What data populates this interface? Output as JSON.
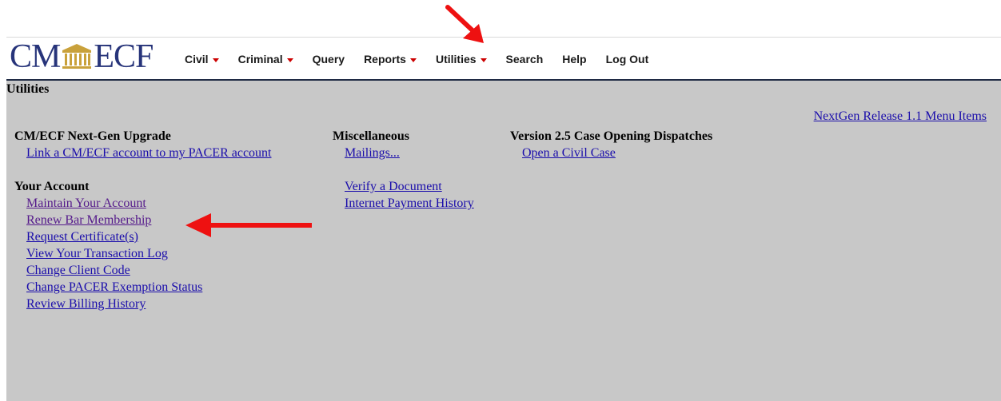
{
  "logo": {
    "left_text": "CM",
    "right_text": "ECF",
    "icon": "courthouse-icon"
  },
  "menu": [
    {
      "label": "Civil",
      "dropdown": true,
      "name": "menu-civil"
    },
    {
      "label": "Criminal",
      "dropdown": true,
      "name": "menu-criminal"
    },
    {
      "label": "Query",
      "dropdown": false,
      "name": "menu-query"
    },
    {
      "label": "Reports",
      "dropdown": true,
      "name": "menu-reports"
    },
    {
      "label": "Utilities",
      "dropdown": true,
      "name": "menu-utilities"
    },
    {
      "label": "Search",
      "dropdown": false,
      "name": "menu-search"
    },
    {
      "label": "Help",
      "dropdown": false,
      "name": "menu-help"
    },
    {
      "label": "Log Out",
      "dropdown": false,
      "name": "menu-logout"
    }
  ],
  "page_title": "Utilities",
  "nextgen_link": "NextGen Release 1.1 Menu Items",
  "columns": {
    "col1": {
      "sections": [
        {
          "heading": "CM/ECF Next-Gen Upgrade",
          "links": [
            "Link a CM/ECF account to my PACER account"
          ]
        },
        {
          "heading": "Your Account",
          "links": [
            "Maintain Your Account",
            "Renew Bar Membership",
            "Request Certificate(s)",
            "View Your Transaction Log",
            "Change Client Code",
            "Change PACER Exemption Status",
            "Review Billing History"
          ]
        }
      ]
    },
    "col2": {
      "heading": "Miscellaneous",
      "links": [
        "Mailings...",
        "Verify a Document",
        "Internet Payment History"
      ]
    },
    "col3": {
      "heading": "Version 2.5 Case Opening Dispatches",
      "links": [
        "Open a Civil Case"
      ]
    }
  },
  "colors": {
    "brand": "#27347a",
    "link": "#1a0dab",
    "visited": "#551a8b",
    "background": "#c8c8c8",
    "annotation": "#ee1111",
    "caret": "#cc0000"
  },
  "annotations": [
    "arrow-to-utilities-menu",
    "arrow-to-renew-bar-membership"
  ]
}
